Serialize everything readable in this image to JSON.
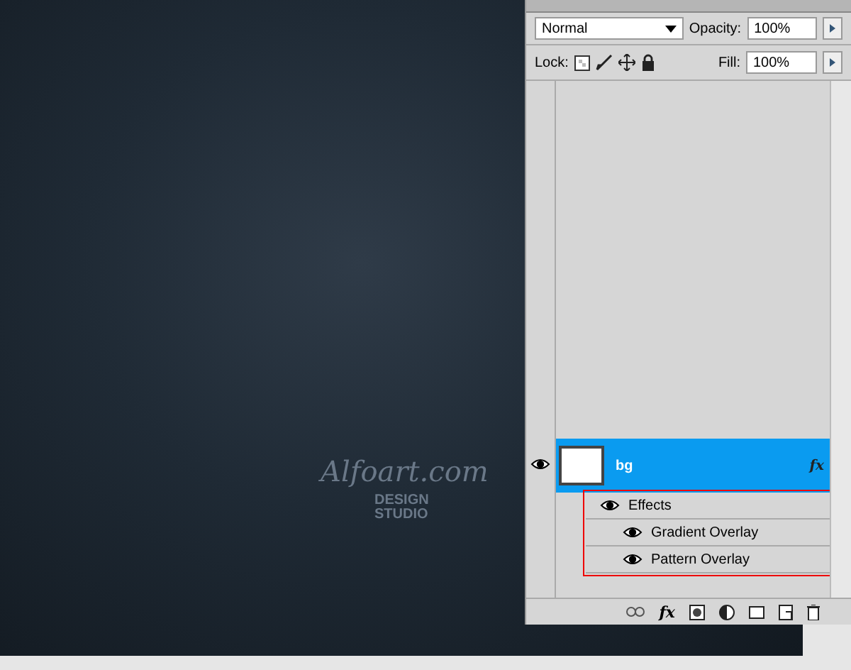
{
  "canvas": {
    "logo": "Alfoart.com",
    "subtitle": [
      "DESIGN",
      "STUDIO"
    ]
  },
  "layers_panel": {
    "blend_mode": "Normal",
    "opacity_label": "Opacity:",
    "opacity": "100%",
    "lock_label": "Lock:",
    "fill_label": "Fill:",
    "fill": "100%",
    "layers": [
      {
        "name": "bg",
        "selected": true,
        "visible": true,
        "fx": "fx",
        "effects_label": "Effects",
        "effects": [
          {
            "name": "Gradient Overlay",
            "visible": true
          },
          {
            "name": "Pattern Overlay",
            "visible": true
          }
        ]
      }
    ],
    "highlight_effects": true,
    "toolbar_fx": "fx"
  }
}
